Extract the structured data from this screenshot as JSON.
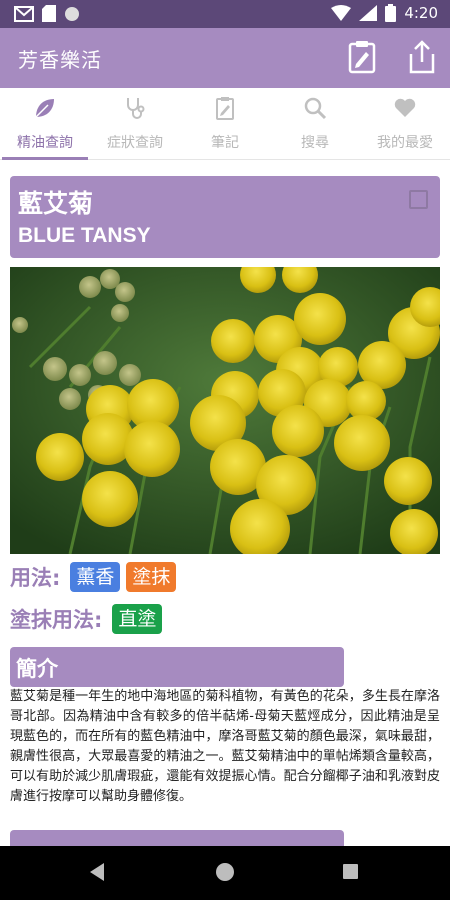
{
  "status_bar": {
    "time": "4:20"
  },
  "app_bar": {
    "title": "芳香樂活",
    "actions": [
      "clipboard-icon",
      "share-icon"
    ]
  },
  "tabs": [
    {
      "label": "精油查詢",
      "icon": "leaf-icon",
      "active": true
    },
    {
      "label": "症狀查詢",
      "icon": "stethoscope-icon",
      "active": false
    },
    {
      "label": "筆記",
      "icon": "notepad-icon",
      "active": false
    },
    {
      "label": "搜尋",
      "icon": "search-icon",
      "active": false
    },
    {
      "label": "我的最愛",
      "icon": "heart-icon",
      "active": false
    }
  ],
  "oil": {
    "name_cn": "藍艾菊",
    "name_en": "BLUE TANSY",
    "favorite_checked": false
  },
  "usage": {
    "label": "用法:",
    "chips": [
      {
        "text": "薰香",
        "color": "#4a7fe0"
      },
      {
        "text": "塗抹",
        "color": "#f07a2c"
      }
    ]
  },
  "apply_usage": {
    "label": "塗抹用法:",
    "chips": [
      {
        "text": "直塗",
        "color": "#1aa14a"
      }
    ]
  },
  "intro": {
    "header": "簡介",
    "text": "藍艾菊是種一年生的地中海地區的菊科植物，有黃色的花朵，多生長在摩洛哥北部。因為精油中含有較多的倍半萜烯-母菊天藍烴成分，因此精油是呈現藍色的，而在所有的藍色精油中，摩洛哥藍艾菊的顏色最深，氣味最甜，親膚性很高，大眾最喜愛的精油之一。藍艾菊精油中的單帖烯類含量較高，可以有助於減少肌膚瑕疵，還能有效提振心情。配合分餾椰子油和乳液對皮膚進行按摩可以幫助身體修復。"
  },
  "colors": {
    "accent": "#a68bc0",
    "status_bar": "#5c4878",
    "accent_text": "#9a7fb6"
  }
}
